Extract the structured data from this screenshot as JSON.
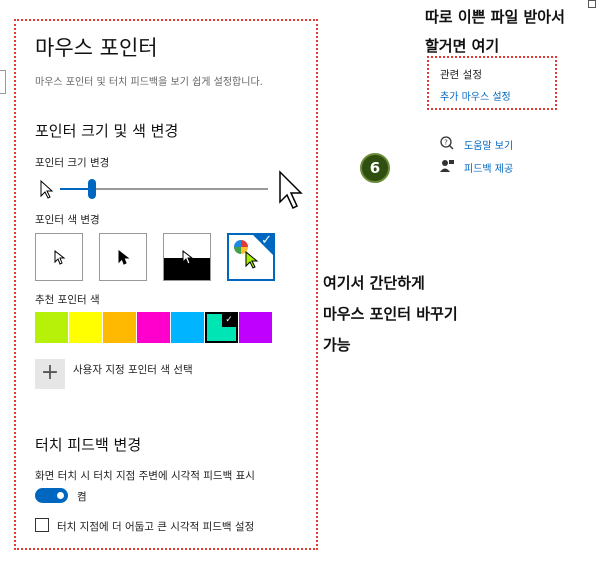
{
  "window": {
    "title": "마우스 포인터",
    "description": "마우스 포인터 및 터치 피드백을 보기 쉽게 설정합니다."
  },
  "pointer_section": {
    "heading": "포인터 크기 및 색 변경",
    "size_label": "포인터 크기 변경",
    "size_level": 0.15,
    "color_label": "포인터 색 변경",
    "color_options": [
      "white",
      "black",
      "inverted",
      "custom"
    ],
    "selected_color_option": "custom",
    "recommended_label": "추천 포인터 색",
    "recommended_colors": [
      "#b7f008",
      "#ffff00",
      "#ffb900",
      "#ff00cc",
      "#00b4ff",
      "#00e5b4",
      "#c000ff"
    ],
    "selected_recommended_index": 5,
    "custom_color_label": "사용자 지정 포인터 색 선택"
  },
  "touch_section": {
    "heading": "터치 피드백 변경",
    "visual_feedback_label": "화면 터치 시 터치 지점 주변에 시각적 피드백 표시",
    "toggle_state": "켬",
    "darker_feedback_label": "터치 지점에 더 어둡고 큰 시각적 피드백 설정",
    "darker_feedback_checked": false
  },
  "related": {
    "heading": "관련 설정",
    "link": "추가 마우스 설정"
  },
  "help": {
    "get_help": "도움말 보기",
    "feedback": "피드백 제공"
  },
  "annotations": {
    "top_note_line1": "따로 이쁜 파일 받아서",
    "top_note_line2": "할거면 여기",
    "step_number": "6",
    "side_note_line1": "여기서 간단하게",
    "side_note_line2": "마우스 포인터 바꾸기",
    "side_note_line3": "가능"
  },
  "colors": {
    "accent": "#0067c0",
    "annotation_border": "#e53935",
    "badge": "#2e4f0f"
  }
}
